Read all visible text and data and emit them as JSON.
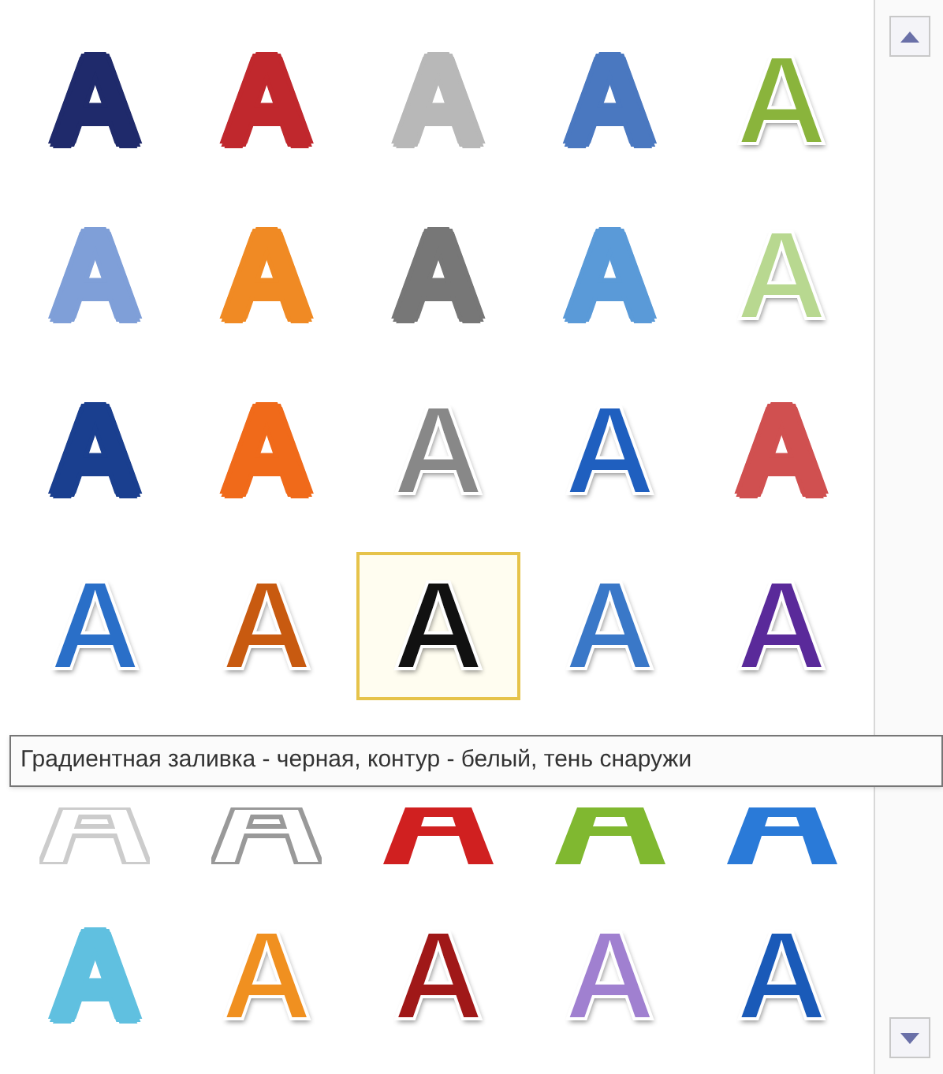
{
  "gallery": {
    "items": [
      {
        "label": "A",
        "kind": "outline",
        "color": "#1f2a6b",
        "selected": false
      },
      {
        "label": "A",
        "kind": "outline",
        "color": "#c0282d",
        "selected": false
      },
      {
        "label": "A",
        "kind": "outline",
        "color": "#b8b8b8",
        "selected": false
      },
      {
        "label": "A",
        "kind": "outline",
        "color": "#4a78c0",
        "selected": false
      },
      {
        "label": "A",
        "kind": "solid",
        "color": "#8ab43c",
        "selected": false
      },
      {
        "label": "A",
        "kind": "outline",
        "color": "#7f9fd8",
        "selected": false
      },
      {
        "label": "A",
        "kind": "outline",
        "color": "#f08a24",
        "selected": false
      },
      {
        "label": "A",
        "kind": "outline",
        "color": "#777777",
        "selected": false
      },
      {
        "label": "A",
        "kind": "outline",
        "color": "#5a9ad8",
        "selected": false
      },
      {
        "label": "A",
        "kind": "solid",
        "color": "#b8d890",
        "selected": false
      },
      {
        "label": "A",
        "kind": "outline",
        "color": "#1a3f8f",
        "selected": false
      },
      {
        "label": "A",
        "kind": "outline",
        "color": "#f06a1a",
        "selected": false
      },
      {
        "label": "A",
        "kind": "solid",
        "color": "#888888",
        "selected": false
      },
      {
        "label": "A",
        "kind": "solid",
        "color": "#1f5fbf",
        "selected": false
      },
      {
        "label": "A",
        "kind": "outline",
        "color": "#d05050",
        "selected": false
      },
      {
        "label": "A",
        "kind": "solid",
        "color": "#2a6fc8",
        "selected": false
      },
      {
        "label": "A",
        "kind": "solid",
        "color": "#c85a10",
        "selected": false
      },
      {
        "label": "A",
        "kind": "solid",
        "color": "#111111",
        "selected": true
      },
      {
        "label": "A",
        "kind": "solid",
        "color": "#3a78c8",
        "selected": false
      },
      {
        "label": "A",
        "kind": "solid",
        "color": "#5a2a9a",
        "selected": false
      },
      {
        "kind": "outline",
        "color": "#cccccc",
        "selected": false
      },
      {
        "kind": "outline",
        "color": "#999999",
        "selected": false
      },
      {
        "kind": "solid",
        "color": "#d02020",
        "selected": false
      },
      {
        "kind": "solid",
        "color": "#80b830",
        "selected": false
      },
      {
        "kind": "solid",
        "color": "#2a7ad8",
        "selected": false
      },
      {
        "label": "A",
        "kind": "outline",
        "color": "#60c0e0",
        "selected": false
      },
      {
        "label": "A",
        "kind": "solid",
        "color": "#f09020",
        "selected": false
      },
      {
        "label": "A",
        "kind": "solid",
        "color": "#a01818",
        "selected": false
      },
      {
        "label": "A",
        "kind": "solid",
        "color": "#a080d0",
        "selected": false
      },
      {
        "label": "A",
        "kind": "solid",
        "color": "#1a5ab8",
        "selected": false
      }
    ]
  },
  "tooltip": {
    "text": "Градиентная заливка - черная, контур - белый, тень снаружи"
  }
}
